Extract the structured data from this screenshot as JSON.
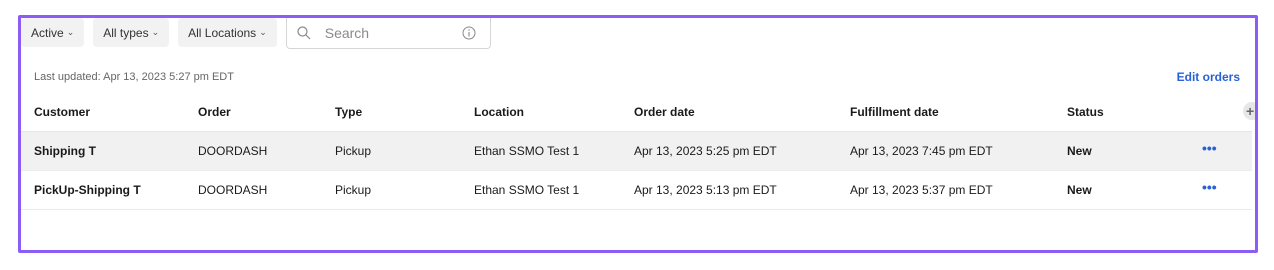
{
  "filters": {
    "status": "Active",
    "types": "All types",
    "locations": "All Locations"
  },
  "search": {
    "placeholder": "Search"
  },
  "last_updated": "Last updated: Apr 13, 2023 5:27 pm EDT",
  "edit_orders": "Edit orders",
  "table": {
    "headers": {
      "customer": "Customer",
      "order": "Order",
      "type": "Type",
      "location": "Location",
      "order_date": "Order date",
      "fulfillment_date": "Fulfillment date",
      "status": "Status"
    },
    "add_column": "+",
    "rows": [
      {
        "customer": "Shipping T",
        "order": "DOORDASH",
        "type": "Pickup",
        "location": "Ethan SSMO Test 1",
        "order_date": "Apr 13, 2023 5:25 pm EDT",
        "fulfillment_date": "Apr 13, 2023 7:45 pm EDT",
        "status": "New",
        "more": "•••"
      },
      {
        "customer": "PickUp-Shipping T",
        "order": "DOORDASH",
        "type": "Pickup",
        "location": "Ethan SSMO Test 1",
        "order_date": "Apr 13, 2023 5:13 pm EDT",
        "fulfillment_date": "Apr 13, 2023 5:37 pm EDT",
        "status": "New",
        "more": "•••"
      }
    ]
  },
  "colors": {
    "accent": "#2a62d6",
    "frame": "#8b5cf6",
    "chip_bg": "#f2f2f2",
    "row_shade": "#f1f1f1"
  },
  "icons": {
    "search": "search-icon",
    "info": "info-icon",
    "chevron": "chevron-down-icon",
    "more": "more-icon",
    "add": "plus-icon"
  }
}
